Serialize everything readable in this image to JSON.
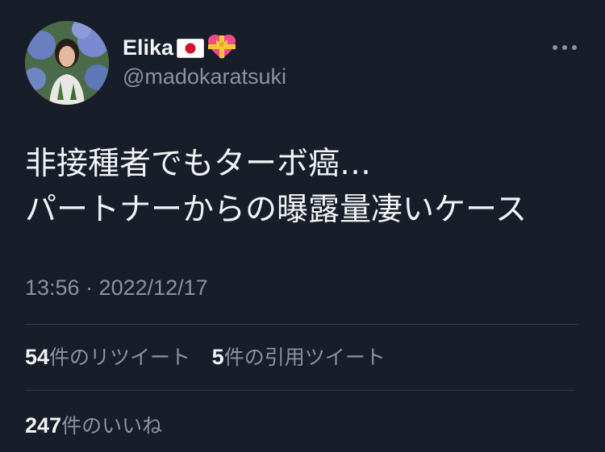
{
  "user": {
    "display_name": "Elika",
    "handle": "@madokaratsuki",
    "avatar_icon": "profile-photo",
    "flag_icon": "japan-flag-icon",
    "badge_icon": "heart-with-ribbon-icon"
  },
  "tweet": {
    "lines": [
      "非接種者でもターボ癌…",
      "パートナーからの曝露量凄いケース"
    ],
    "timestamp": "13:56 · 2022/12/17"
  },
  "stats": {
    "retweets_count": "54",
    "retweets_label": "件のリツイート",
    "quotes_count": "5",
    "quotes_label": "件の引用ツイート",
    "likes_count": "247",
    "likes_label": "件のいいね"
  },
  "colors": {
    "background": "#171d29",
    "text_primary": "#f2f3f5",
    "text_secondary": "#8b949e",
    "divider": "#333a45"
  }
}
